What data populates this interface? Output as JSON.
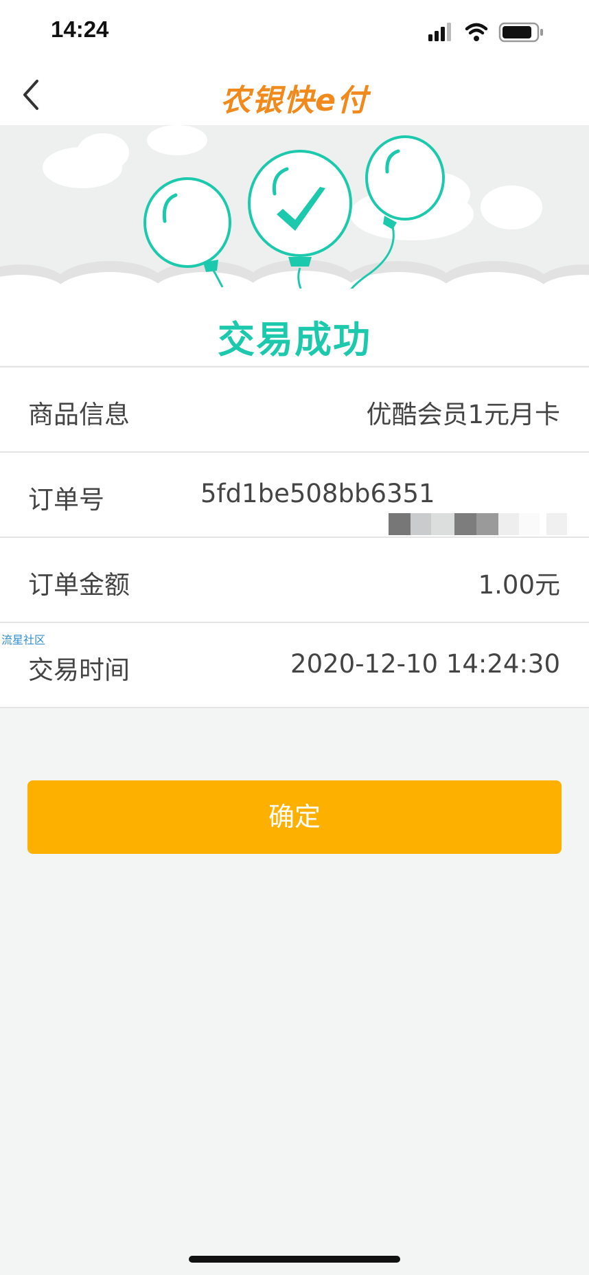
{
  "status_bar": {
    "time": "14:24"
  },
  "nav": {
    "logo_text": "农银快e付",
    "back_icon": "chevron-left-icon"
  },
  "hero": {
    "title": "交易成功"
  },
  "rows": [
    {
      "label": "商品信息",
      "value": "优酷会员1元月卡"
    },
    {
      "label": "订单号",
      "value": "5fd1be508bb6351"
    },
    {
      "label": "订单金额",
      "value": "1.00元"
    },
    {
      "label": "交易时间",
      "value": "2020-12-10 14:24:30"
    }
  ],
  "watermark": "流星社区",
  "confirm_label": "确定",
  "colors": {
    "accent": "#1dc9ad",
    "button": "#fdb000",
    "logo": "#f08a1c"
  }
}
